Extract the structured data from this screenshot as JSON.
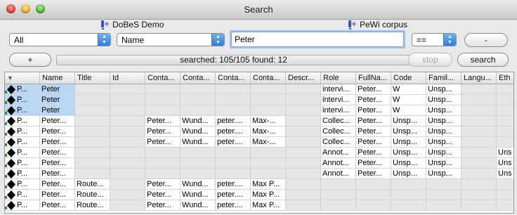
{
  "window": {
    "title": "Search"
  },
  "corpora": [
    {
      "name": "DoBeS Demo",
      "icon": "corpus-icon"
    },
    {
      "name": "PeWi corpus",
      "icon": "corpus-icon"
    }
  ],
  "controls": {
    "scope_select": "All",
    "field_select": "Name",
    "search_value": "Peter",
    "operator_select": "==",
    "add_label": "+",
    "remove_label": "-",
    "status": "searched: 105/105 found: 12",
    "stop_label": "stop",
    "search_label": "search"
  },
  "table": {
    "columns": [
      "Name",
      "Title",
      "Id",
      "Conta...",
      "Conta...",
      "Conta...",
      "Conta...",
      "Descr...",
      "Role",
      "FullNa...",
      "Code",
      "Famil...",
      "Langu...",
      "Eth"
    ],
    "rows": [
      {
        "label": "P...",
        "selected": true,
        "cells": [
          "Peter",
          "",
          "",
          "",
          "",
          "",
          "",
          "",
          "intervi...",
          "Peter...",
          "W",
          "Unsp...",
          "",
          ""
        ]
      },
      {
        "label": "P...",
        "selected": true,
        "cells": [
          "Peter",
          "",
          "",
          "",
          "",
          "",
          "",
          "",
          "intervi...",
          "Peter...",
          "W",
          "Unsp...",
          "",
          ""
        ]
      },
      {
        "label": "P...",
        "selected": true,
        "cells": [
          "Peter",
          "",
          "",
          "",
          "",
          "",
          "",
          "",
          "intervi...",
          "Peter...",
          "W",
          "Unsp...",
          "",
          ""
        ]
      },
      {
        "label": "P...",
        "selected": false,
        "cells": [
          "Peter...",
          "",
          "",
          "Peter...",
          "Wund...",
          "peter....",
          "Max-...",
          "",
          "Collec...",
          "Peter...",
          "Unsp...",
          "Unsp...",
          "",
          ""
        ]
      },
      {
        "label": "P...",
        "selected": false,
        "cells": [
          "Peter...",
          "",
          "",
          "Peter...",
          "Wund...",
          "peter....",
          "Max-...",
          "",
          "Collec...",
          "Peter...",
          "Unsp...",
          "Unsp...",
          "",
          ""
        ]
      },
      {
        "label": "P...",
        "selected": false,
        "cells": [
          "Peter...",
          "",
          "",
          "Peter...",
          "Wund...",
          "peter....",
          "Max-...",
          "",
          "Collec...",
          "Peter...",
          "Unsp...",
          "Unsp...",
          "",
          ""
        ]
      },
      {
        "label": "P...",
        "selected": false,
        "cells": [
          "Peter...",
          "",
          "",
          "",
          "",
          "",
          "",
          "",
          "Annot...",
          "Peter...",
          "Unsp...",
          "Unsp...",
          "",
          "Uns"
        ]
      },
      {
        "label": "P...",
        "selected": false,
        "cells": [
          "Peter...",
          "",
          "",
          "",
          "",
          "",
          "",
          "",
          "Annot...",
          "Peter...",
          "Unsp...",
          "Unsp...",
          "",
          "Uns"
        ]
      },
      {
        "label": "P...",
        "selected": false,
        "cells": [
          "Peter...",
          "",
          "",
          "",
          "",
          "",
          "",
          "",
          "Annot...",
          "Peter...",
          "Unsp...",
          "Unsp...",
          "",
          "Uns"
        ]
      },
      {
        "label": "P...",
        "selected": false,
        "cells": [
          "Peter...",
          "Route...",
          "",
          "Peter...",
          "Wund...",
          "peter....",
          "Max P...",
          "",
          "",
          "",
          "",
          "",
          "",
          ""
        ]
      },
      {
        "label": "P...",
        "selected": false,
        "cells": [
          "Peter...",
          "Route...",
          "",
          "Peter...",
          "Wund...",
          "peter....",
          "Max P...",
          "",
          "",
          "",
          "",
          "",
          "",
          ""
        ]
      },
      {
        "label": "P...",
        "selected": false,
        "cells": [
          "Peter...",
          "Route...",
          "",
          "Peter...",
          "Wund...",
          "peter....",
          "Max P...",
          "",
          "",
          "",
          "",
          "",
          "",
          ""
        ]
      }
    ]
  }
}
